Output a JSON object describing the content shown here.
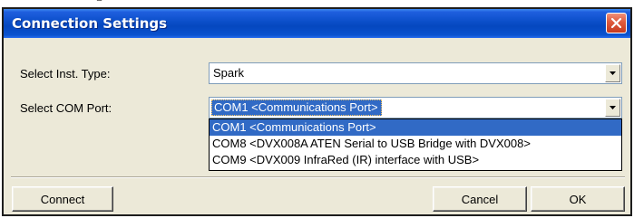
{
  "page_caption": "…nection Settings",
  "dialog": {
    "title": "Connection Settings",
    "close_icon": "close-icon"
  },
  "form": {
    "inst_type_label": "Select Inst. Type:",
    "inst_type_value": "Spark",
    "com_port_label": "Select COM Port:",
    "com_port_value": "COM1 <Communications Port>",
    "com_port_options": [
      "COM1 <Communications Port>",
      "COM8 <DVX008A ATEN Serial to USB Bridge with DVX008>",
      "COM9 <DVX009 InfraRed (IR) interface with USB>"
    ]
  },
  "buttons": {
    "connect": "Connect",
    "cancel": "Cancel",
    "ok": "OK"
  },
  "colors": {
    "title_bar": "#0a4ec8",
    "selection": "#316ac5",
    "close_button": "#de5a3c",
    "dialog_bg": "#ece9d8"
  }
}
